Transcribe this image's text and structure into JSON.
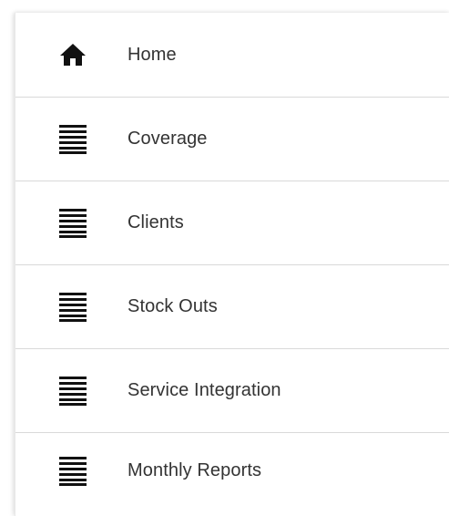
{
  "nav": {
    "items": [
      {
        "label": "Home",
        "icon": "home-icon"
      },
      {
        "label": "Coverage",
        "icon": "list-icon"
      },
      {
        "label": "Clients",
        "icon": "list-icon"
      },
      {
        "label": "Stock Outs",
        "icon": "list-icon"
      },
      {
        "label": "Service Integration",
        "icon": "list-icon"
      },
      {
        "label": "Monthly Reports",
        "icon": "list-icon"
      }
    ]
  },
  "colors": {
    "text": "#333333",
    "divider": "#d9d9d9",
    "icon": "#111111",
    "background": "#ffffff"
  }
}
